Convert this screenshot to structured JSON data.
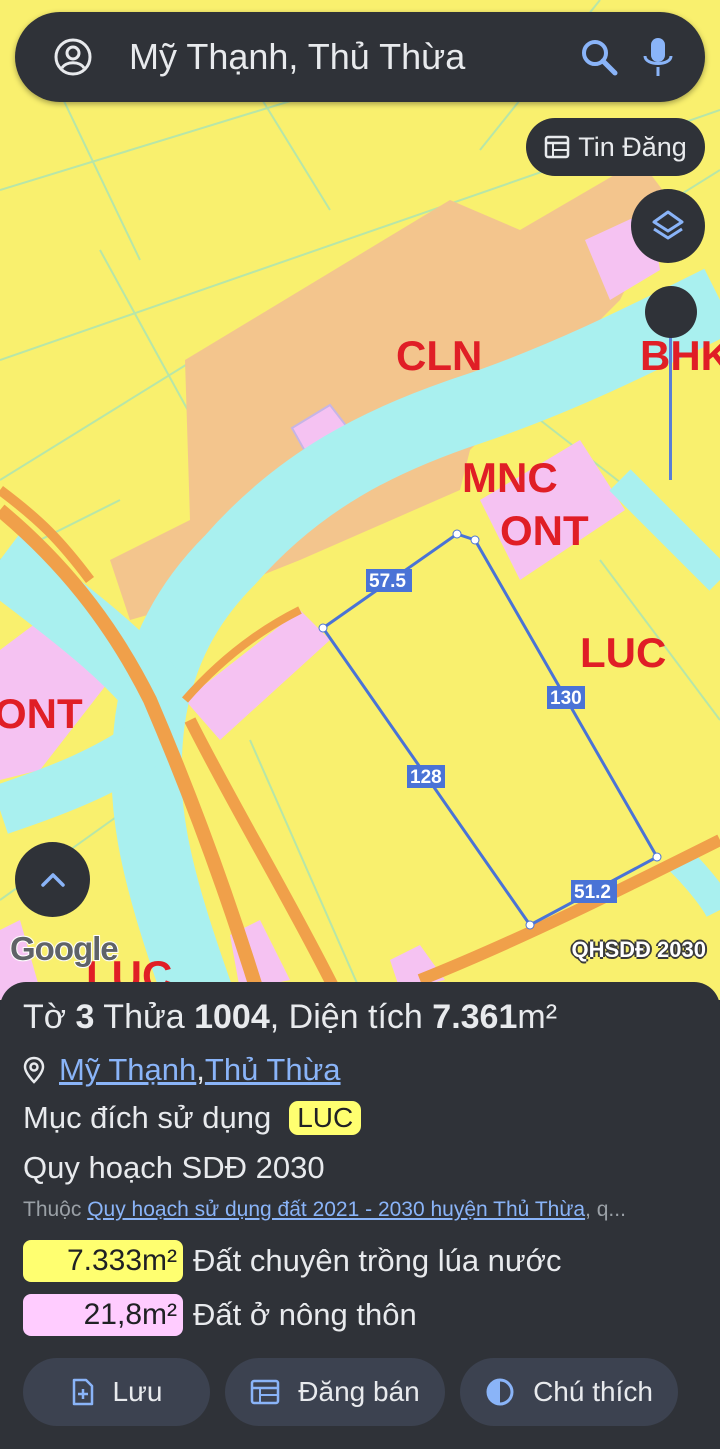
{
  "search": {
    "query": "Mỹ Thạnh, Thủ Thừa"
  },
  "map_controls": {
    "tin_dang_label": "Tin Đăng",
    "google_logo": "Google",
    "map_year_label": "QHSDĐ 2030"
  },
  "map_labels": {
    "cln": "CLN",
    "bhk": "BHK",
    "mnc": "MNC",
    "ont_top": "ONT",
    "ont_left": "ONT",
    "luc_right": "LUC",
    "luc_bottom": "LUC"
  },
  "parcel_dimensions": {
    "top": "57.5",
    "left": "128",
    "right": "130",
    "bottom": "51.2"
  },
  "parcel": {
    "sheet_label": "Tờ",
    "sheet": "3",
    "plot_label": "Thửa",
    "plot": "1004",
    "area_label": ", Diện tích",
    "area": "7.361",
    "area_unit": "m²",
    "commune": "Mỹ Thạnh",
    "separator": ", ",
    "district": "Thủ Thừa",
    "purpose_label": "Mục đích sử dụng",
    "purpose_code": "LUC",
    "plan_label": "Quy hoạch SDĐ 2030",
    "belongs_label": "Thuộc ",
    "belongs_link": "Quy hoạch sử dụng đất 2021 - 2030 huyện Thủ Thừa",
    "belongs_suffix": ", q..."
  },
  "land_use": [
    {
      "area": "7.333m²",
      "description": "Đất chuyên trồng lúa nước",
      "color": "#ffff70"
    },
    {
      "area": "21,8m²",
      "description": "Đất ở nông thôn",
      "color": "#ffccff"
    }
  ],
  "actions": [
    {
      "label": "Lưu",
      "icon": "add-bookmark-icon"
    },
    {
      "label": "Đăng bán",
      "icon": "listing-icon"
    },
    {
      "label": "Chú thích",
      "icon": "contrast-icon"
    }
  ],
  "colors": {
    "accent": "#8ab4f8",
    "panel": "#2f3238",
    "map_yellow": "#f9f06e",
    "water": "#a9f0ef",
    "cln": "#f3c58d",
    "residential": "#f5c2f2"
  }
}
